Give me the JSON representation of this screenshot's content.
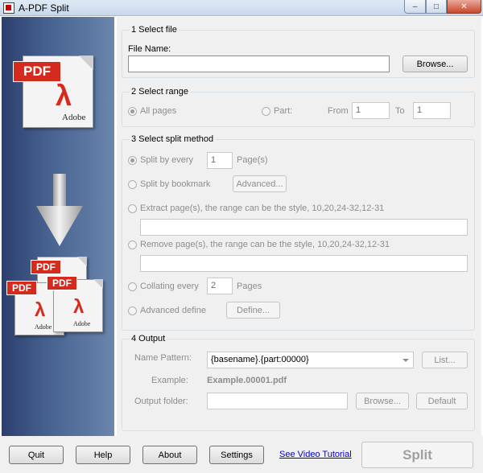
{
  "window": {
    "title": "A-PDF Split"
  },
  "banner": {
    "top_doc": {
      "tag": "PDF",
      "brand": "Adobe"
    },
    "docs": [
      {
        "tag": "PDF",
        "brand": "Adobe"
      },
      {
        "tag": "PDF",
        "brand": "Adobe"
      },
      {
        "tag": "PDF",
        "brand": "Adobe"
      }
    ]
  },
  "select_file": {
    "title": "1 Select file",
    "file_name_label": "File Name:",
    "file_name_value": "",
    "browse": "Browse..."
  },
  "select_range": {
    "title": "2 Select range",
    "all_pages": "All pages",
    "part": "Part:",
    "from_label": "From",
    "from_value": "1",
    "to_label": "To",
    "to_value": "1"
  },
  "split_method": {
    "title": "3 Select split method",
    "split_every": "Split by every",
    "split_every_value": "1",
    "pages_unit": "Page(s)",
    "split_bookmark": "Split by bookmark",
    "advanced": "Advanced...",
    "extract": "Extract page(s), the range can be the style, 10,20,24-32,12-31",
    "extract_value": "",
    "remove": "Remove page(s), the range can be the style, 10,20,24-32,12-31",
    "remove_value": "",
    "collating": "Collating every",
    "collating_value": "2",
    "collating_unit": "Pages",
    "advanced_define": "Advanced define",
    "define": "Define..."
  },
  "output": {
    "title": "4 Output",
    "name_pattern_label": "Name Pattern:",
    "name_pattern_value": "{basename}.{part:00000}",
    "list": "List...",
    "example_label": "Example:",
    "example_value": "Example.00001.pdf",
    "output_folder_label": "Output folder:",
    "output_folder_value": "",
    "browse": "Browse...",
    "default": "Default"
  },
  "footer": {
    "quit": "Quit",
    "help": "Help",
    "about": "About",
    "settings": "Settings",
    "video_tutorial": "See Video Tutorial",
    "split": "Split"
  }
}
